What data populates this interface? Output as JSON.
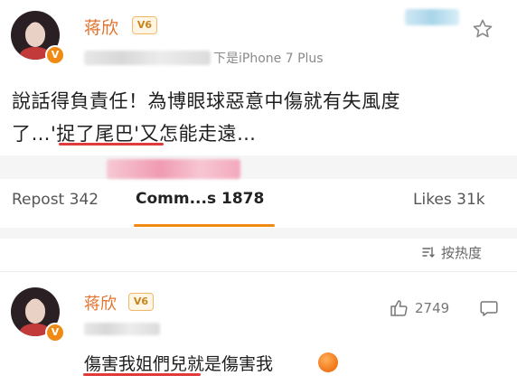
{
  "post": {
    "author": "蒋欣",
    "level_badge": "V6",
    "verified_mark": "V",
    "source": "下是iPhone 7 Plus",
    "body_line1": "說話得負責任！為博眼球惡意中傷就有失風度",
    "body_line2_a": "了…",
    "body_line2_highlight": "'捉了尾巴'",
    "body_line2_b": "又怎能走遠…",
    "icons": {
      "star": "star-icon",
      "verified": "verified-badge-icon"
    }
  },
  "tabs": {
    "repost": "Repost 342",
    "comments": "Comm...s 1878",
    "likes": "Likes 31k"
  },
  "sort": {
    "label": "按热度",
    "icon": "sort-icon"
  },
  "comment": {
    "author": "蒋欣",
    "level_badge": "V6",
    "like_count": "2749",
    "text_highlight": "傷害我姐們兒",
    "text_rest": "就是傷害我",
    "icons": {
      "like": "thumbs-up-icon",
      "more": "comment-bubble-icon",
      "emoji": "orange-emoji-icon"
    }
  },
  "colors": {
    "accent": "#f08a14",
    "name": "#e2722c",
    "underline": "#e03a3a"
  }
}
